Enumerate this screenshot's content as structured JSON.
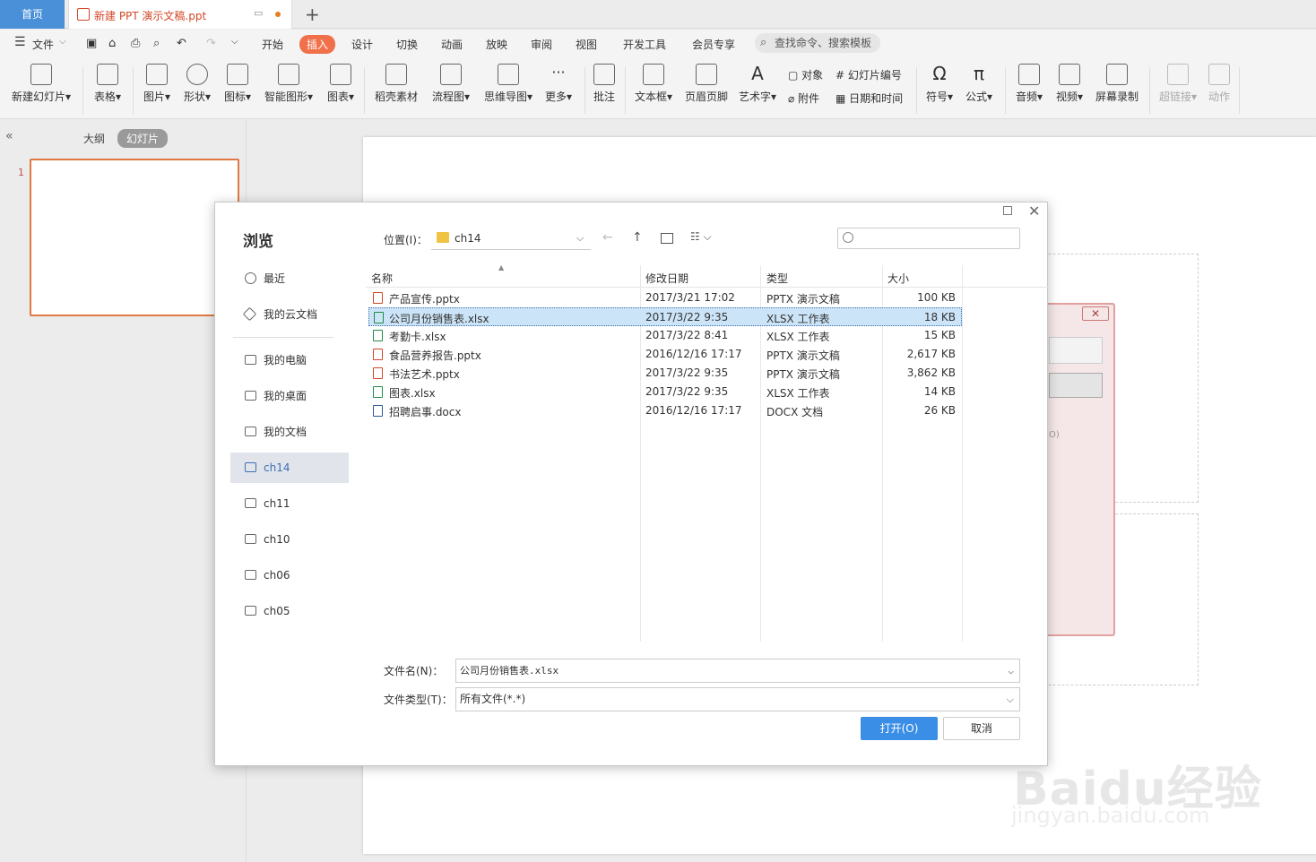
{
  "tabs": {
    "home": "首页",
    "doc": "新建 PPT 演示文稿.ppt",
    "new_tab": "+"
  },
  "menu": {
    "file": "文件",
    "items": [
      "开始",
      "插入",
      "设计",
      "切换",
      "动画",
      "放映",
      "审阅",
      "视图",
      "开发工具",
      "会员专享"
    ],
    "active": "插入",
    "search": "查找命令、搜索模板"
  },
  "ribbon": {
    "buttons": [
      "新建幻灯片",
      "表格",
      "图片",
      "形状",
      "图标",
      "智能图形",
      "图表",
      "稻壳素材",
      "流程图",
      "思维导图",
      "更多",
      "批注",
      "文本框",
      "页眉页脚",
      "艺术字",
      "符号",
      "公式",
      "音频",
      "视频",
      "屏幕录制",
      "超链接",
      "动作"
    ],
    "small": [
      "对象",
      "幻灯片编号",
      "附件",
      "日期和时间"
    ]
  },
  "left_panel": {
    "outline": "大纲",
    "slides": "幻灯片",
    "slide_number": "1"
  },
  "dialog": {
    "title": "浏览",
    "nav": [
      "最近",
      "我的云文档",
      "我的电脑",
      "我的桌面",
      "我的文档",
      "ch14",
      "ch11",
      "ch10",
      "ch06",
      "ch05"
    ],
    "nav_active": "ch14",
    "location_label": "位置(I)：",
    "location_value": "ch14",
    "columns": [
      "名称",
      "修改日期",
      "类型",
      "大小"
    ],
    "files": [
      {
        "name": "产品宣传.pptx",
        "date": "2017/3/21 17:02",
        "type": "PPTX 演示文稿",
        "size": "100 KB",
        "kind": "ppt"
      },
      {
        "name": "公司月份销售表.xlsx",
        "date": "2017/3/22 9:35",
        "type": "XLSX 工作表",
        "size": "18 KB",
        "kind": "xls",
        "selected": true
      },
      {
        "name": "考勤卡.xlsx",
        "date": "2017/3/22 8:41",
        "type": "XLSX 工作表",
        "size": "15 KB",
        "kind": "xls"
      },
      {
        "name": "食品营养报告.pptx",
        "date": "2016/12/16 17:17",
        "type": "PPTX 演示文稿",
        "size": "2,617 KB",
        "kind": "ppt"
      },
      {
        "name": "书法艺术.pptx",
        "date": "2017/3/22 9:35",
        "type": "PPTX 演示文稿",
        "size": "3,862 KB",
        "kind": "ppt"
      },
      {
        "name": "图表.xlsx",
        "date": "2017/3/22 9:35",
        "type": "XLSX 工作表",
        "size": "14 KB",
        "kind": "xls"
      },
      {
        "name": "招聘启事.docx",
        "date": "2016/12/16 17:17",
        "type": "DOCX 文档",
        "size": "26 KB",
        "kind": "doc"
      }
    ],
    "filename_label": "文件名(N)：",
    "filename_value": "公司月份销售表.xlsx",
    "filetype_label": "文件类型(T)：",
    "filetype_value": "所有文件(*.*)",
    "open": "打开(O)",
    "cancel": "取消"
  },
  "bg_dialog": {
    "close": "✕",
    "fragment": "O)"
  },
  "watermark": {
    "logo": "Baidu经验",
    "url": "jingyan.baidu.com"
  }
}
